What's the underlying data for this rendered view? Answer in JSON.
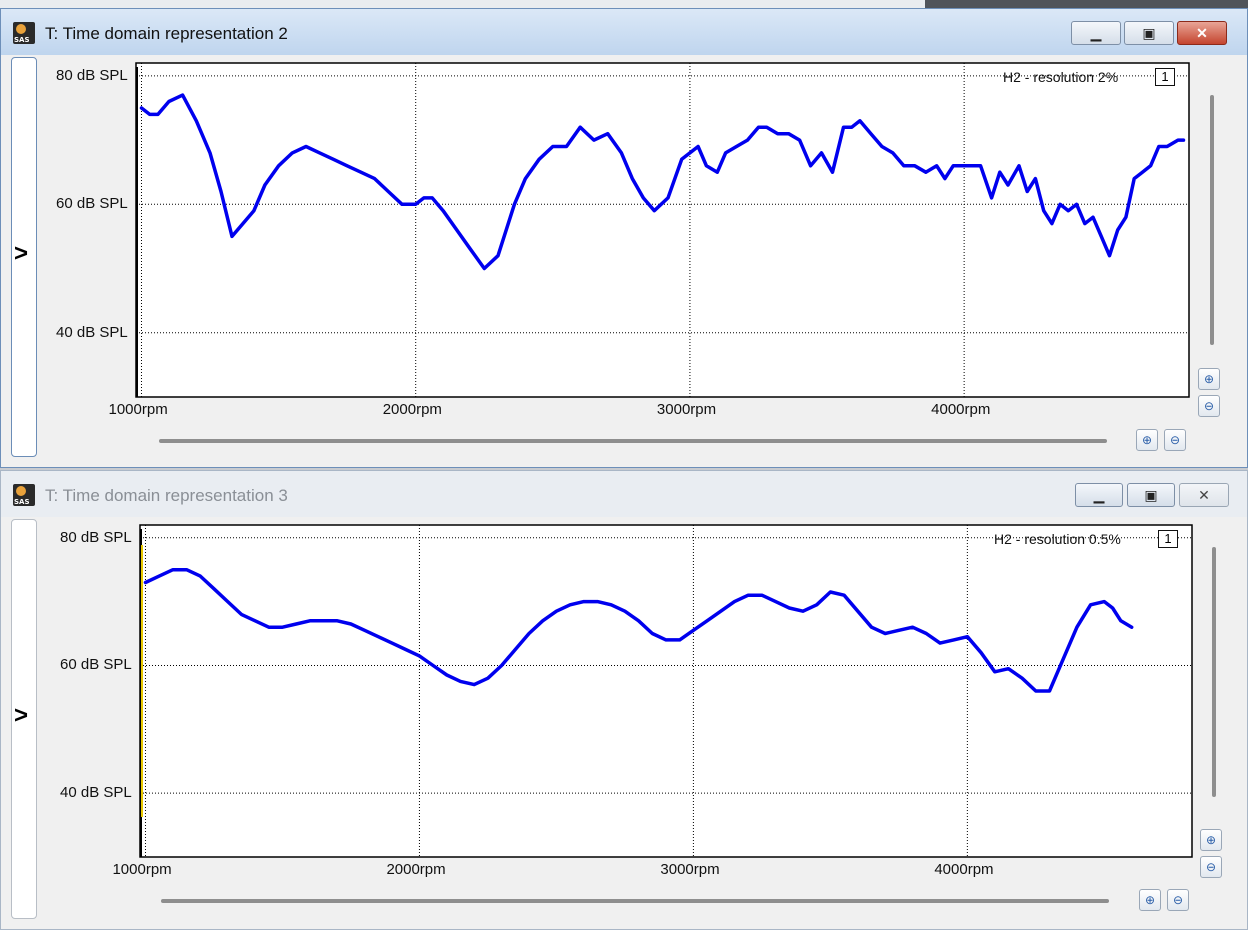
{
  "windows": [
    {
      "title": "T: Time domain representation 2",
      "side_label": ">",
      "legend": "H2 - resolution 2%",
      "legend_index": "1",
      "chart_data": {
        "type": "line",
        "xlabel": "",
        "ylabel": "",
        "x_ticks": [
          "1000rpm",
          "2000rpm",
          "3000rpm",
          "4000rpm"
        ],
        "y_ticks": [
          "80 dB SPL",
          "60 dB SPL",
          "40 dB SPL"
        ],
        "xlim": [
          980,
          4820
        ],
        "ylim": [
          30,
          82
        ],
        "grid": true,
        "legend_position": "top-right",
        "series": [
          {
            "color": "#0000ee",
            "x": [
              1000,
              1030,
              1060,
              1100,
              1150,
              1200,
              1250,
              1290,
              1330,
              1370,
              1410,
              1450,
              1500,
              1550,
              1600,
              1650,
              1700,
              1750,
              1800,
              1850,
              1900,
              1950,
              2000,
              2030,
              2060,
              2100,
              2150,
              2200,
              2250,
              2300,
              2330,
              2360,
              2400,
              2450,
              2500,
              2550,
              2600,
              2650,
              2700,
              2750,
              2790,
              2830,
              2870,
              2920,
              2970,
              3030,
              3060,
              3100,
              3130,
              3170,
              3210,
              3250,
              3280,
              3320,
              3360,
              3400,
              3440,
              3480,
              3520,
              3560,
              3590,
              3620,
              3660,
              3700,
              3740,
              3780,
              3820,
              3860,
              3900,
              3930,
              3960,
              3990,
              4020,
              4060,
              4100,
              4130,
              4160,
              4200,
              4230,
              4260,
              4290,
              4320,
              4350,
              4380,
              4410,
              4440,
              4470,
              4500,
              4530,
              4560,
              4590,
              4620,
              4650,
              4680,
              4710,
              4740,
              4780,
              4800
            ],
            "y": [
              75,
              74,
              74,
              76,
              77,
              73,
              68,
              62,
              55,
              57,
              59,
              63,
              66,
              68,
              69,
              68,
              67,
              66,
              65,
              64,
              62,
              60,
              60,
              61,
              61,
              59,
              56,
              53,
              50,
              52,
              56,
              60,
              64,
              67,
              69,
              69,
              72,
              70,
              71,
              68,
              64,
              61,
              59,
              61,
              67,
              69,
              66,
              65,
              68,
              69,
              70,
              72,
              72,
              71,
              71,
              70,
              66,
              68,
              65,
              72,
              72,
              73,
              71,
              69,
              68,
              66,
              66,
              65,
              66,
              64,
              66,
              66,
              66,
              66,
              61,
              65,
              63,
              66,
              62,
              64,
              59,
              57,
              60,
              59,
              60,
              57,
              58,
              55,
              52,
              56,
              58,
              64,
              65,
              66,
              69,
              69,
              70,
              70
            ]
          }
        ]
      }
    },
    {
      "title": "T: Time domain representation 3",
      "side_label": ">",
      "legend": "H2 - resolution 0.5%",
      "legend_index": "1",
      "chart_data": {
        "type": "line",
        "xlabel": "",
        "ylabel": "",
        "x_ticks": [
          "1000rpm",
          "2000rpm",
          "3000rpm",
          "4000rpm"
        ],
        "y_ticks": [
          "80 dB SPL",
          "60 dB SPL",
          "40 dB SPL"
        ],
        "xlim": [
          980,
          4820
        ],
        "ylim": [
          30,
          82
        ],
        "grid": true,
        "legend_position": "top-right",
        "series": [
          {
            "color": "#0000ee",
            "x": [
              1000,
              1050,
              1100,
              1150,
              1200,
              1250,
              1300,
              1350,
              1400,
              1450,
              1500,
              1550,
              1600,
              1650,
              1700,
              1750,
              1800,
              1850,
              1900,
              1950,
              2000,
              2050,
              2100,
              2150,
              2200,
              2250,
              2300,
              2350,
              2400,
              2450,
              2500,
              2550,
              2600,
              2650,
              2700,
              2750,
              2800,
              2850,
              2900,
              2950,
              3000,
              3050,
              3100,
              3150,
              3200,
              3250,
              3300,
              3350,
              3400,
              3450,
              3500,
              3550,
              3600,
              3650,
              3700,
              3750,
              3800,
              3850,
              3900,
              3950,
              4000,
              4050,
              4100,
              4150,
              4200,
              4250,
              4300,
              4350,
              4400,
              4450,
              4500,
              4530,
              4560,
              4600,
              4650,
              4700,
              4750,
              4800
            ],
            "y": [
              73,
              74,
              75,
              75,
              74,
              72,
              70,
              68,
              67,
              66,
              66,
              66.5,
              67,
              67,
              67,
              66.5,
              65.5,
              64.5,
              63.5,
              62.5,
              61.5,
              60,
              58.5,
              57.5,
              57,
              58,
              60,
              62.5,
              65,
              67,
              68.5,
              69.5,
              70,
              70,
              69.5,
              68.5,
              67,
              65,
              64,
              64,
              65.5,
              67,
              68.5,
              70,
              71,
              71,
              70,
              69,
              68.5,
              69.5,
              71.5,
              71,
              68.5,
              66,
              65,
              65.5,
              66,
              65,
              63.5,
              64,
              64.5,
              62,
              59,
              59.5,
              58,
              56,
              56,
              61,
              66,
              69.5,
              70,
              69,
              67,
              66
            ]
          }
        ]
      }
    }
  ]
}
